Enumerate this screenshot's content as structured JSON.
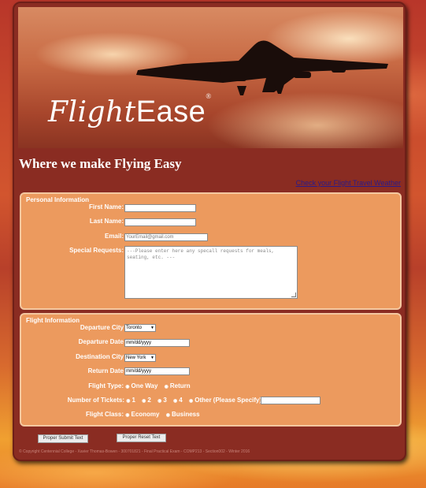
{
  "brand": {
    "logo_flight": "Flight",
    "logo_ease": "Ease",
    "logo_reg": "®"
  },
  "tagline": "Where we make Flying Easy",
  "weather_link": "Check your Flight Travel Weather",
  "personal": {
    "legend": "Personal Information",
    "first_name_label": "First Name:",
    "last_name_label": "Last Name:",
    "email_label": "Email:",
    "email_placeholder": "YourEmail@gmail.com",
    "requests_label": "Special Requests:",
    "requests_placeholder": "---Please enter here any specall requests for meals, seating, etc. ---"
  },
  "flight": {
    "legend": "Flight Information",
    "departure_city_label": "Departure City",
    "departure_city_value": "Toronto",
    "departure_date_label": "Departure Date",
    "departure_date_placeholder": "mm/dd/yyyy",
    "destination_city_label": "Destination City",
    "destination_city_value": "New York",
    "return_date_label": "Return Date",
    "return_date_placeholder": "mm/dd/yyyy",
    "flight_type_label": "Flight Type:",
    "flight_type_options": [
      "One Way",
      "Return"
    ],
    "tickets_label": "Number of Tickets:",
    "tickets_options": [
      "1",
      "2",
      "3",
      "4",
      "Other (Please Specify):"
    ],
    "class_label": "Flight Class:",
    "class_options": [
      "Economy",
      "Business"
    ]
  },
  "buttons": {
    "submit": "Proper Submit Text",
    "reset": "Proper Reset Text"
  },
  "footer": "© Copyright Centennial College - Xavier Thomas-Bowen - 300701821 - Final Practical Exam - COMP213 - Section002 - Winter 2016",
  "radio_glyph": "◉"
}
